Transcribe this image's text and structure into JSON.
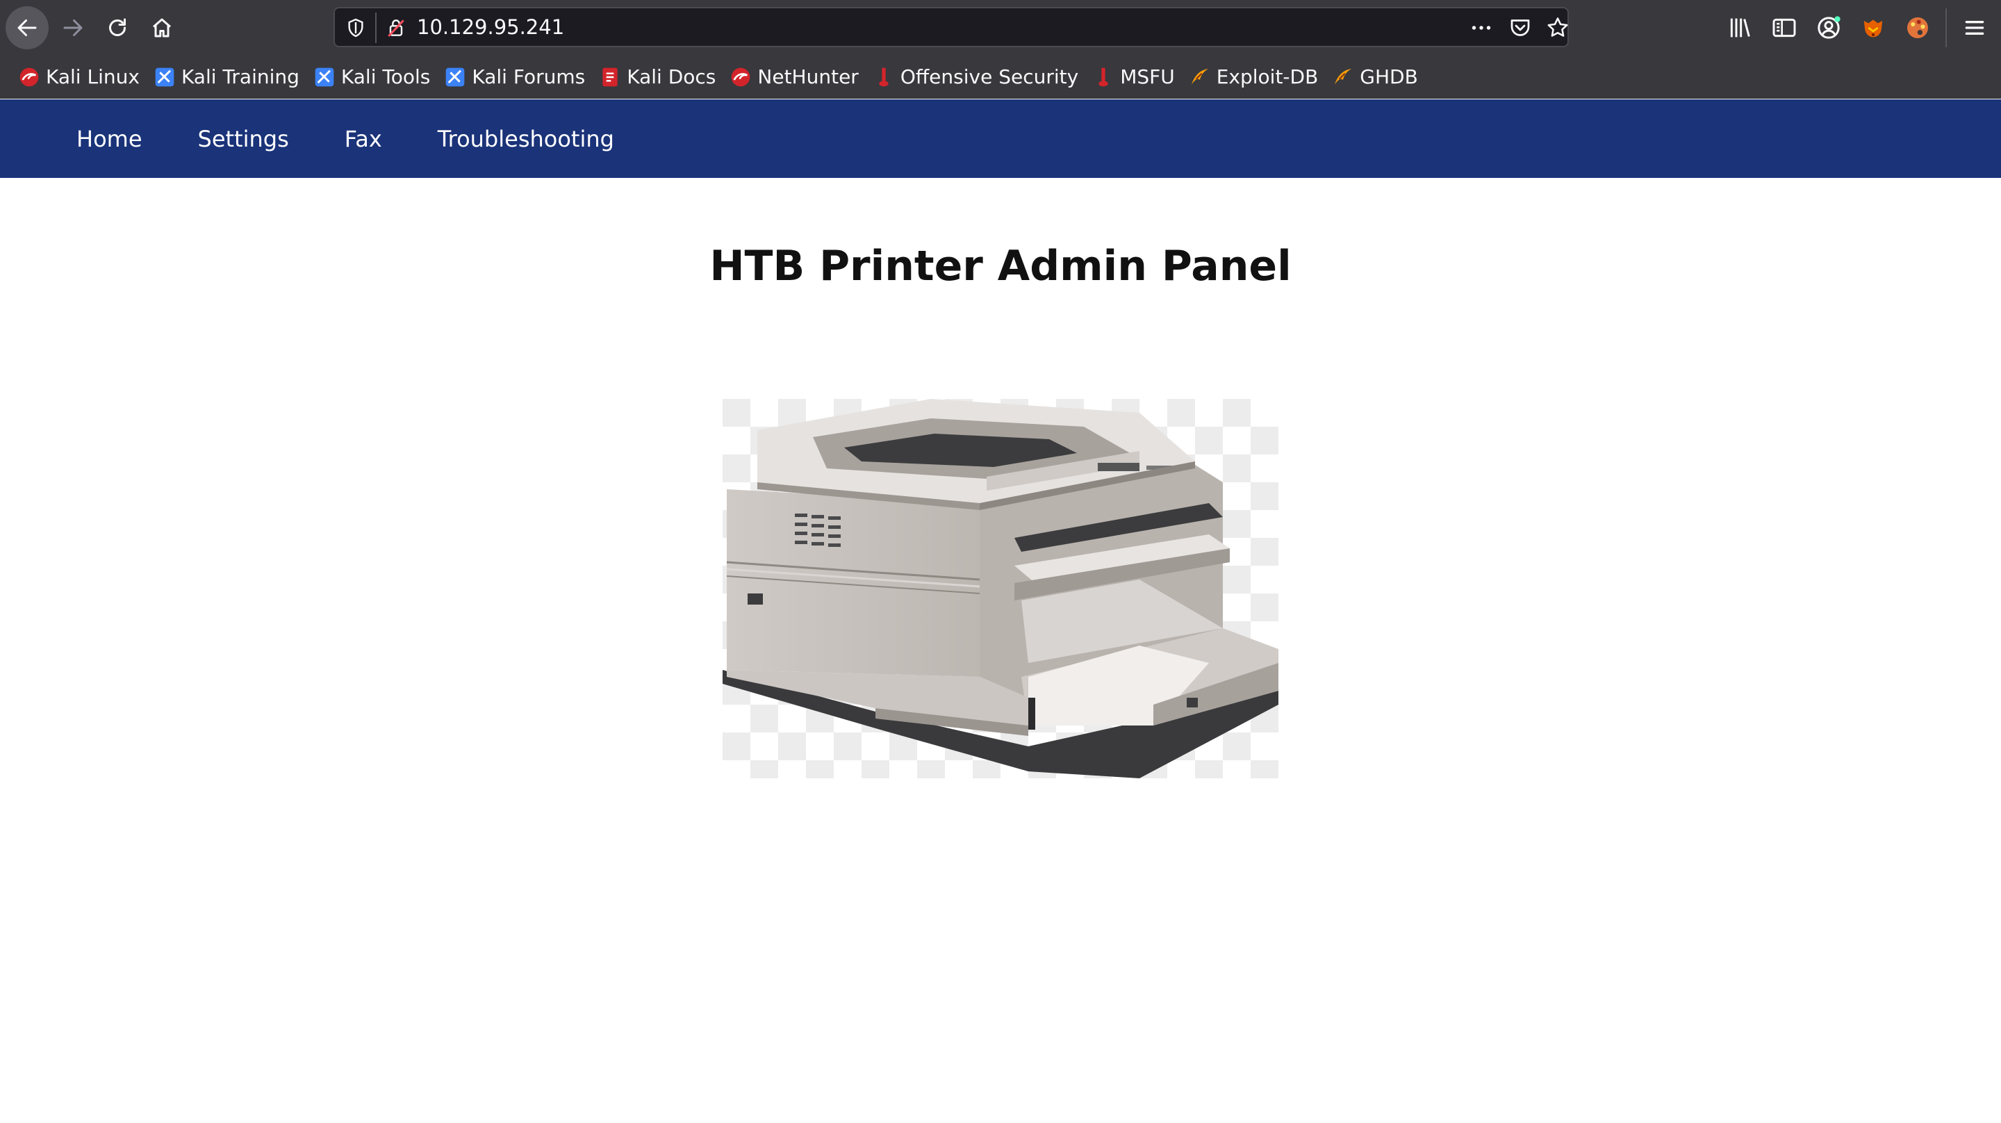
{
  "browser": {
    "url": "10.129.95.241",
    "bookmarks": [
      {
        "label": "Kali Linux",
        "icon": "kali-dragon-icon"
      },
      {
        "label": "Kali Training",
        "icon": "kali-training-icon"
      },
      {
        "label": "Kali Tools",
        "icon": "kali-tools-icon"
      },
      {
        "label": "Kali Forums",
        "icon": "kali-forums-icon"
      },
      {
        "label": "Kali Docs",
        "icon": "kali-docs-icon"
      },
      {
        "label": "NetHunter",
        "icon": "nethunter-icon"
      },
      {
        "label": "Offensive Security",
        "icon": "offsec-icon"
      },
      {
        "label": "MSFU",
        "icon": "msfu-icon"
      },
      {
        "label": "Exploit-DB",
        "icon": "exploit-db-icon"
      },
      {
        "label": "GHDB",
        "icon": "ghdb-icon"
      }
    ]
  },
  "page": {
    "nav": [
      "Home",
      "Settings",
      "Fax",
      "Troubleshooting"
    ],
    "title": "HTB Printer Admin Panel"
  },
  "colors": {
    "nav_bg": "#1a3379",
    "chrome_bg": "#38383d",
    "urlbar_bg": "#1c1b22"
  }
}
